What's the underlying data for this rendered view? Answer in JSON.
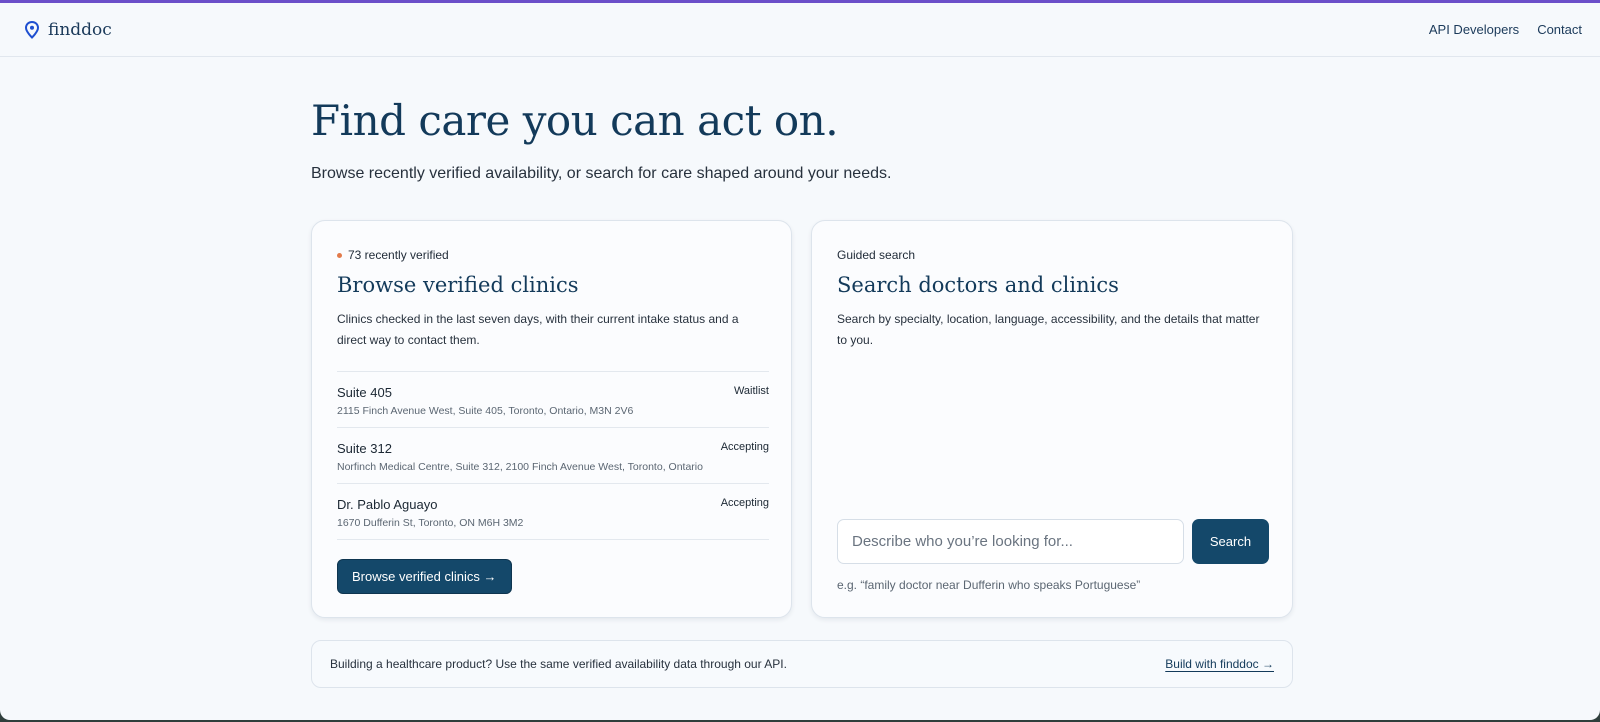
{
  "brand": {
    "name": "finddoc",
    "icon": "map-pin-icon",
    "color": "#1e4fd0"
  },
  "nav": {
    "items": [
      "API Developers",
      "Contact"
    ]
  },
  "hero": {
    "title": "Find care you can act on.",
    "subtitle": "Browse recently verified availability, or search for care shaped around your needs."
  },
  "browse_card": {
    "badge": "73 recently verified",
    "title": "Browse verified clinics",
    "description": "Clinics checked in the last seven days, with their current intake status and a direct way to contact them.",
    "clinics": [
      {
        "name": "Suite 405",
        "address": "2115 Finch Avenue West, Suite 405, Toronto, Ontario, M3N 2V6",
        "status": "Waitlist"
      },
      {
        "name": "Suite 312",
        "address": "Norfinch Medical Centre, Suite 312, 2100 Finch Avenue West, Toronto, Ontario",
        "status": "Accepting"
      },
      {
        "name": "Dr. Pablo Aguayo",
        "address": "1670 Dufferin St, Toronto, ON M6H 3M2",
        "status": "Accepting"
      }
    ],
    "button_label": "Browse verified clinics →"
  },
  "search_card": {
    "eyebrow": "Guided search",
    "title": "Search doctors and clinics",
    "description": "Search by specialty, location, language, accessibility, and the details that matter to you.",
    "placeholder": "Describe who you’re looking for...",
    "button_label": "Search",
    "hint": "e.g. “family doctor near Dufferin who speaks Portuguese”"
  },
  "api_bar": {
    "text": "Building a healthcare product? Use the same verified availability data through our API.",
    "link_label": "Build with finddoc →"
  },
  "colors": {
    "primary": "#14486a",
    "accent_dot": "#e27a4a",
    "heading": "#133a5a",
    "top_border": "#6b4fc9"
  }
}
